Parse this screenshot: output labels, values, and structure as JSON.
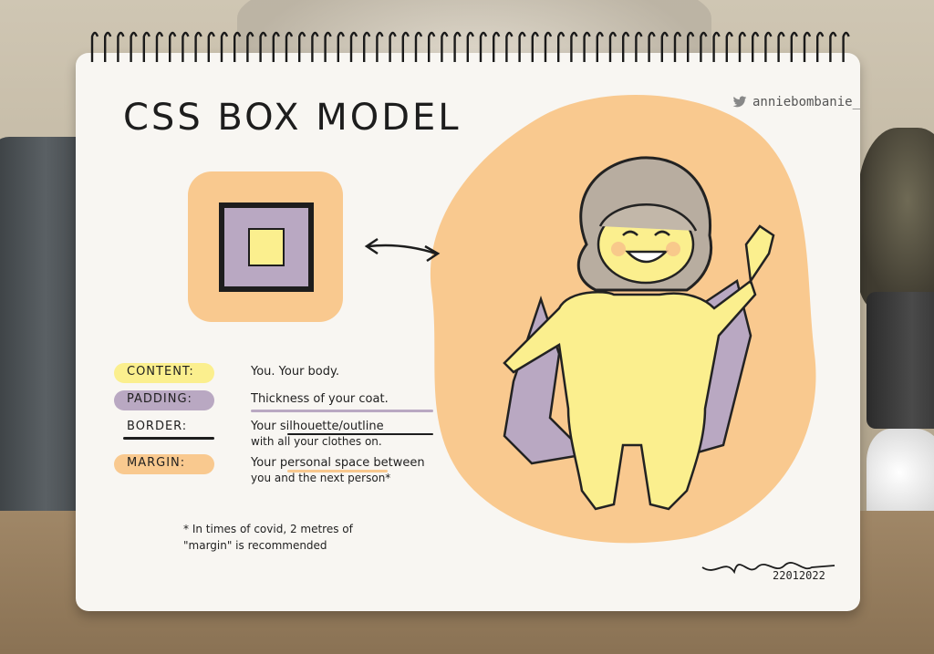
{
  "title": "CSS BOX MODEL",
  "handle": "anniebombanie_",
  "handle_icon": "twitter-bird-icon",
  "colors": {
    "margin": "#f9c98f",
    "padding": "#b9a8c2",
    "content": "#fbef8e",
    "border": "#1d1d1d",
    "paper": "#f8f6f2"
  },
  "definitions": [
    {
      "label": "CONTENT:",
      "desc": "You. Your body.",
      "desc2": ""
    },
    {
      "label": "PADDING:",
      "desc": "Thickness of your coat.",
      "desc2": ""
    },
    {
      "label": "BORDER:",
      "desc": "Your silhouette/outline",
      "desc2": "with all your clothes on."
    },
    {
      "label": "MARGIN:",
      "desc": "Your personal space between",
      "desc2": "you and the next person*"
    }
  ],
  "footnote": {
    "line1": "* In times of covid, 2 metres of",
    "line2": "\"margin\" is recommended"
  },
  "date": "22012022"
}
